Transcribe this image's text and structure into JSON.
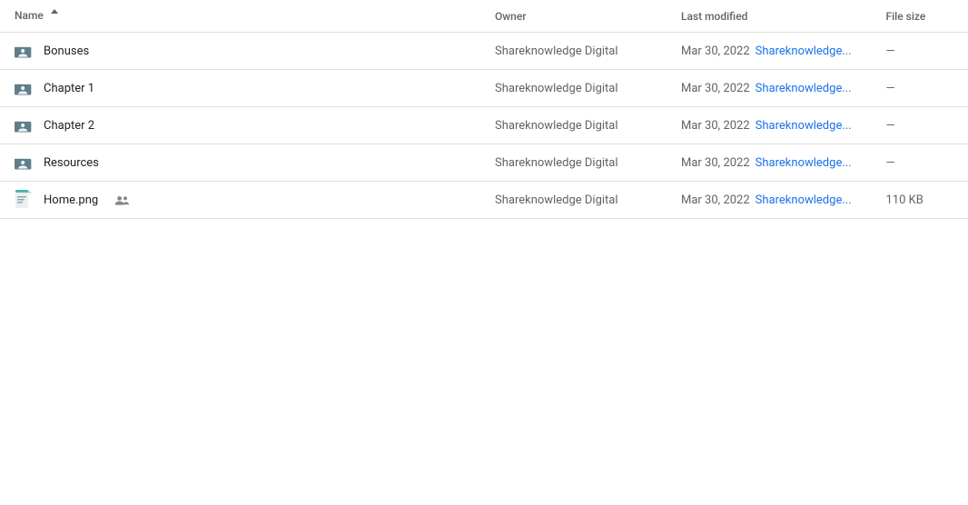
{
  "table": {
    "headers": {
      "name": "Name",
      "owner": "Owner",
      "modified": "Last modified",
      "size": "File size"
    },
    "rows": [
      {
        "id": "bonuses",
        "name": "Bonuses",
        "type": "shared-folder",
        "owner": "Shareknowledge Digital",
        "modified_date": "Mar 30, 2022",
        "modified_editor": "Shareknowledge...",
        "size": "—",
        "shared": false
      },
      {
        "id": "chapter1",
        "name": "Chapter 1",
        "type": "shared-folder",
        "owner": "Shareknowledge Digital",
        "modified_date": "Mar 30, 2022",
        "modified_editor": "Shareknowledge...",
        "size": "—",
        "shared": false
      },
      {
        "id": "chapter2",
        "name": "Chapter 2",
        "type": "shared-folder",
        "owner": "Shareknowledge Digital",
        "modified_date": "Mar 30, 2022",
        "modified_editor": "Shareknowledge...",
        "size": "—",
        "shared": false
      },
      {
        "id": "resources",
        "name": "Resources",
        "type": "shared-folder",
        "owner": "Shareknowledge Digital",
        "modified_date": "Mar 30, 2022",
        "modified_editor": "Shareknowledge...",
        "size": "—",
        "shared": false
      },
      {
        "id": "home-png",
        "name": "Home.png",
        "type": "image",
        "owner": "Shareknowledge Digital",
        "modified_date": "Mar 30, 2022",
        "modified_editor": "Shareknowledge...",
        "size": "110 KB",
        "shared": true
      }
    ]
  }
}
